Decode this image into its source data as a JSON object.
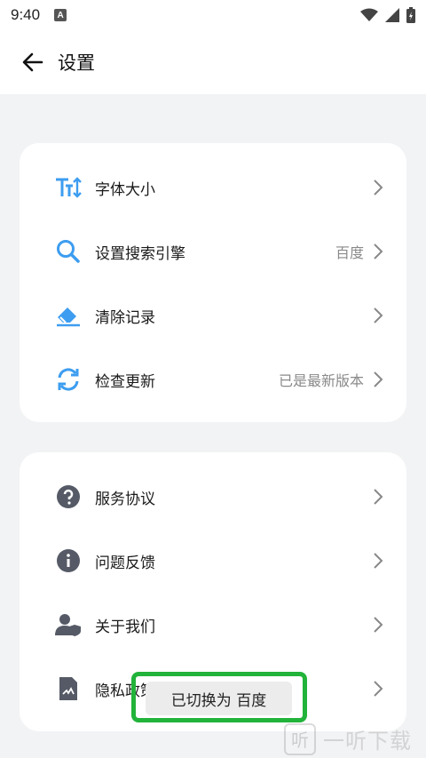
{
  "status_bar": {
    "time": "9:40",
    "notification_letter": "A"
  },
  "header": {
    "title": "设置"
  },
  "card1": {
    "items": [
      {
        "label": "字体大小",
        "value": ""
      },
      {
        "label": "设置搜索引擎",
        "value": "百度"
      },
      {
        "label": "清除记录",
        "value": ""
      },
      {
        "label": "检查更新",
        "value": "已是最新版本"
      }
    ]
  },
  "card2": {
    "items": [
      {
        "label": "服务协议"
      },
      {
        "label": "问题反馈"
      },
      {
        "label": "关于我们"
      },
      {
        "label": "隐私政策"
      }
    ]
  },
  "toast": {
    "text": "已切换为 百度"
  },
  "watermark": {
    "logo": "听",
    "text": "一听下载"
  },
  "colors": {
    "accent": "#3d9df0",
    "icon_gray": "#555a66",
    "toast_border": "#22b33a"
  }
}
